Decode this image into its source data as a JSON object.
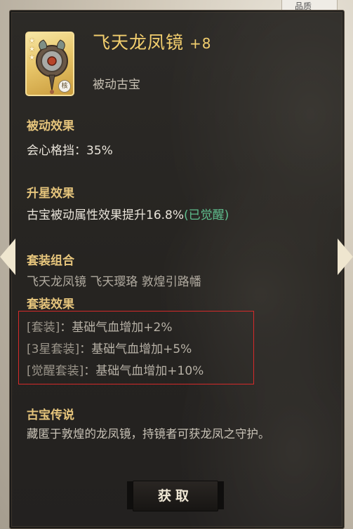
{
  "top_tag": "品质",
  "item": {
    "name": "飞天龙凤镜",
    "level": "+8",
    "type": "被动古宝",
    "stars": 3,
    "badge": "核"
  },
  "passive": {
    "heading": "被动效果",
    "text": "会心格挡：35%"
  },
  "star_up": {
    "heading": "升星效果",
    "text": "古宝被动属性效果提升16.8%",
    "awakened": "(已觉醒)"
  },
  "set_combo": {
    "heading": "套装组合",
    "members": "飞天龙凤镜 飞天璎珞 敦煌引路幡"
  },
  "set_effect": {
    "heading": "套装效果",
    "lines": [
      {
        "label": "[套装]",
        "text": "：基础气血增加+2%"
      },
      {
        "label": "[3星套装]",
        "text": "：基础气血增加+5%"
      },
      {
        "label": "[觉醒套装]",
        "text": "：基础气血增加+10%"
      }
    ]
  },
  "lore": {
    "heading": "古宝传说",
    "text": "藏匿于敦煌的龙凤镜，持镜者可获龙凤之守护。"
  },
  "button": {
    "label": "获取"
  },
  "colors": {
    "title_gold": "#f3cf6e",
    "heading_gold": "#e6c57c",
    "awakened_green": "#5fbf8e",
    "highlight_red": "#d62a2a"
  }
}
